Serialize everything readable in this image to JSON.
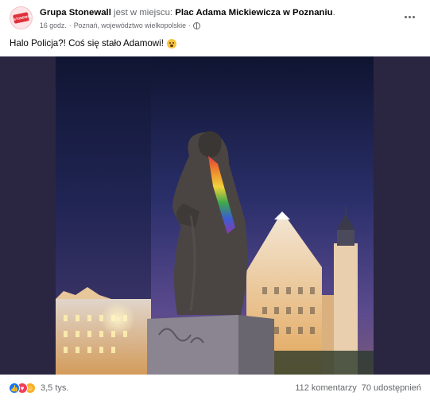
{
  "post": {
    "author": "Grupa Stonewall",
    "connector": " jest w miejscu: ",
    "place": "Plac Adama Mickiewicza w Poznaniu",
    "place_suffix": ".",
    "time": "16 godz.",
    "separator": "·",
    "location": "Poznań, województwo wielkopolskie",
    "audience_icon": "globe-icon",
    "more_icon": "more-horizontal-icon",
    "text": "Halo Policja?! Coś się stało Adamowi!",
    "text_emoji": "worried-face-emoji"
  },
  "footer": {
    "reaction_icons": [
      "like-icon",
      "love-icon",
      "care-icon"
    ],
    "reaction_count": "3,5 tys.",
    "comments": "112 komentarzy",
    "shares": "70 udostępnień"
  },
  "colors": {
    "brand_red": "#e0303b",
    "like_blue": "#1877f2",
    "love_red": "#f33e58",
    "care_yellow": "#f7b125",
    "secondary_text": "#65676b"
  }
}
